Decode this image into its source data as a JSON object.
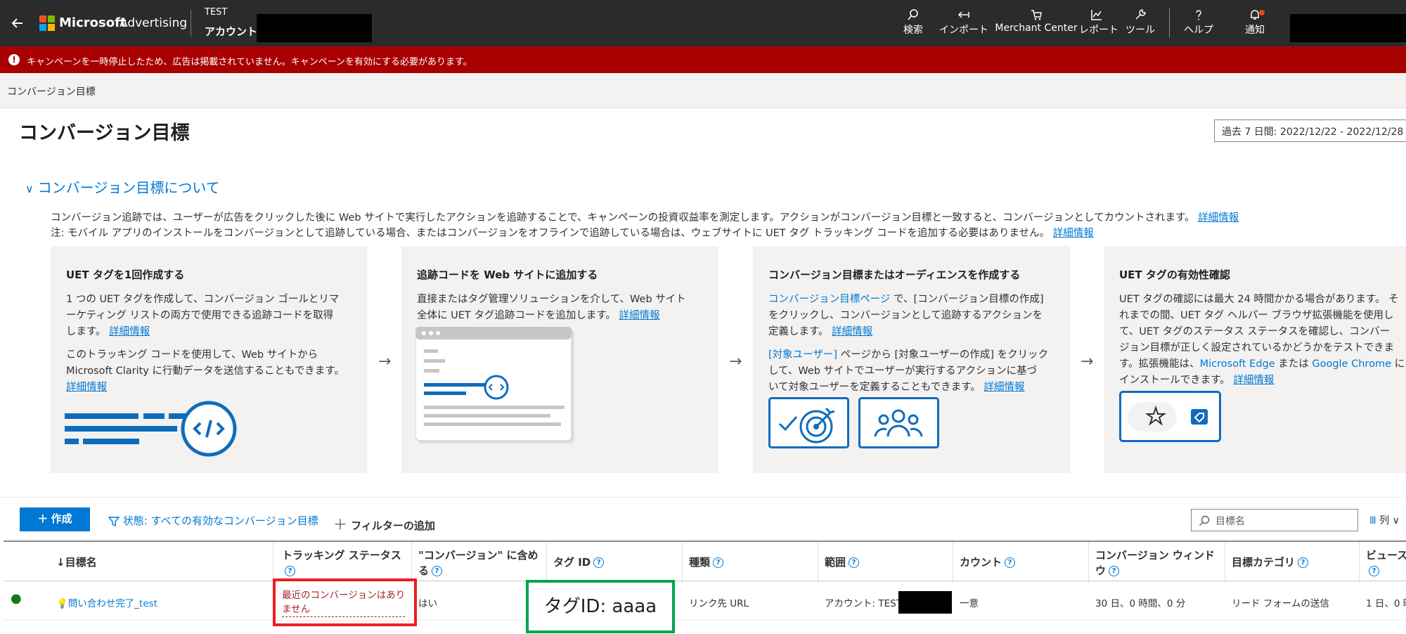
{
  "header": {
    "brand": "Microsoft",
    "product": "Advertising",
    "account_test": "TEST",
    "account_label": "アカウント",
    "nav": [
      {
        "label": "検索",
        "icon": "search-icon"
      },
      {
        "label": "インポート",
        "icon": "import-icon"
      },
      {
        "label": "Merchant Center",
        "icon": "cart-icon"
      },
      {
        "label": "レポート",
        "icon": "chart-icon"
      },
      {
        "label": "ツール",
        "icon": "wrench-icon"
      },
      {
        "label": "ヘルプ",
        "icon": "help-icon"
      },
      {
        "label": "通知",
        "icon": "bell-icon"
      }
    ]
  },
  "banner": {
    "text": "キャンペーンを一時停止したため、広告は掲載されていません。キャンペーンを有効にする必要があります。"
  },
  "breadcrumb": "コンバージョン目標",
  "page": {
    "title": "コンバージョン目標",
    "date_range": "過去 7 日間: 2022/12/22 - 2022/12/28"
  },
  "about": {
    "toggle": "コンバージョン目標について",
    "line1": "コンバージョン追跡では、ユーザーが広告をクリックした後に Web サイトで実行したアクションを追跡することで、キャンペーンの投資収益率を測定します。アクションがコンバージョン目標と一致すると、コンバージョンとしてカウントされます。",
    "line2": "注: モバイル アプリのインストールをコンバージョンとして追跡している場合、またはコンバージョンをオフラインで追跡している場合は、ウェブサイトに UET タグ トラッキング コードを追加する必要はありません。",
    "learn_more": "詳細情報"
  },
  "cards": [
    {
      "title": "UET タグを1回作成する",
      "p1_l1": "1 つの UET タグを作成して、コンバージョン ゴールとリマ",
      "p1_l2": "ーケティング リストの両方で使用できる追跡コードを取得",
      "p1_l3": "します。",
      "p2_l1": "このトラッキング コードを使用して、Web サイトから",
      "p2_l2": "Microsoft Clarity に行動データを送信することもできます。"
    },
    {
      "title": "追跡コードを Web サイトに追加する",
      "p1_l1": "直接またはタグ管理ソリューションを介して、Web サイト",
      "p1_l2": "全体に UET タグ追跡コードを追加します。"
    },
    {
      "title": "コンバージョン目標またはオーディエンスを作成する",
      "p1_link": "コンバージョン目標ページ",
      "p1_l1": " で、[コンバージョン目標の作成]",
      "p1_l2": "をクリックし、コンバージョンとして追跡するアクションを",
      "p1_l3": "定義します。",
      "p2_link": "[対象ユーザー]",
      "p2_l1": " ページから [対象ユーザーの作成] をクリック",
      "p2_l2": "して、Web サイトでユーザーが実行するアクションに基づ",
      "p2_l3": "いて対象ユーザーを定義することもできます。"
    },
    {
      "title": "UET タグの有効性確認",
      "p1_l1": "UET タグの確認には最大 24 時間かかる場合があります。 そ",
      "p1_l2": "れまでの間、UET タグ ヘルパー ブラウザ拡張機能を使用し",
      "p1_l3": "て、UET タグのステータス ステータスを確認し、コンバー",
      "p1_l4": "ジョン目標が正しく設定されているかどうかをテストできま",
      "p1_l5a": "す。拡張機能は、",
      "p1_edge": "Microsoft Edge",
      "p1_or": " または ",
      "p1_chrome": "Google Chrome",
      "p1_ni": " に",
      "p1_l6": "インストールできます。"
    }
  ],
  "toolbar": {
    "create": "作成",
    "filter_status": "状態: すべての有効なコンバージョン目標",
    "add_filter": "フィルターの追加",
    "search_placeholder": "目標名",
    "columns": "列"
  },
  "table": {
    "headers": {
      "name": "目標名",
      "tracking_l1": "トラッキング ステータス",
      "conv_l1": "\"コンバージョン\" に含め",
      "conv_l2": "る",
      "tag_id": "タグ ID",
      "type": "種類",
      "scope": "範囲",
      "count": "カウント",
      "window_l1": "コンバージョン ウィンド",
      "window_l2": "ウ",
      "category": "目標カテゴリ",
      "view": "ビュース"
    },
    "row": {
      "name": "問い合わせ完了_test",
      "tracking_l1": "最近のコンバージョンはあり",
      "tracking_l2": "ません",
      "included": "はい",
      "type": "リンク先 URL",
      "scope": "アカウント: TEST -",
      "count": "一意",
      "window": "30 日、0 時間、0 分",
      "category": "リード フォームの送信",
      "view": "1 日、0 時"
    }
  },
  "annotation": {
    "tag_id_label": "タグID: aaaa"
  },
  "colors": {
    "header_bg": "#2b2b2b",
    "banner_bg": "#a80000",
    "accent": "#0078d4",
    "red_box": "#ee1c25",
    "green_box": "#00a650"
  }
}
